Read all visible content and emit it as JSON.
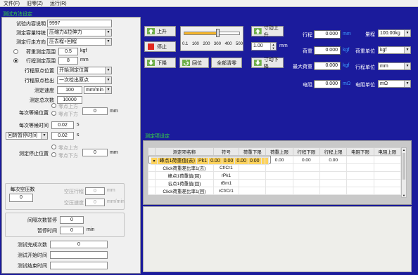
{
  "menu": {
    "file": "文件(F)",
    "history": "旧零(Z)",
    "run": "运行(R)"
  },
  "left": {
    "section_title": "测试方法设定",
    "desc_label": "试验内容说明",
    "desc_value": "9997",
    "char_label": "测定容量特统",
    "char_value": "压缩力&拉伸力",
    "dir_label": "测定行走方向",
    "dir_value": "压去程+回程",
    "load_label": "荷重测定范围",
    "load_value": "0.5",
    "load_unit": "kgf",
    "stroke_label": "行程测定范围",
    "stroke_value": "8",
    "stroke_unit": "mm",
    "startpos_label": "行程原点位置",
    "startpos_value": "开始测定位置",
    "detect_label": "行程原点检出",
    "detect_value": "一次检出原点",
    "speed_label": "测定速度",
    "speed_value": "100",
    "speed_unit": "mm/min",
    "count_label": "测定总次数",
    "count_value": "10000",
    "wait_label": "每次等候位置",
    "wait_opt1": "零点上方",
    "wait_opt2": "零点下方",
    "wait_value": "0",
    "wait_unit": "mm",
    "waittime_label": "每次等候时间",
    "waittime_value": "0.02",
    "waittime_unit": "s",
    "pause_select": "回转暂停时间",
    "pause_value": "0.02",
    "pause_unit": "s",
    "stop_label": "测定停止位置",
    "stop_opt1": "零点上方",
    "stop_opt2": "零点下方",
    "stop_value": "0",
    "stop_unit": "mm",
    "air_label": "每次空压数",
    "air_value": "0",
    "air_stroke_label": "空压行程",
    "air_stroke_value": "0",
    "air_stroke_unit": "mm",
    "air_speed_label": "空压速度",
    "air_speed_value": "0",
    "air_speed_unit": "mm/min",
    "interval_label": "间隔次数暂停",
    "interval_value": "0",
    "pausetime_label": "暂停时间",
    "pausetime_value": "0",
    "pausetime_unit": "min",
    "done_label": "测试完成次数",
    "done_value": "0",
    "starttime_label": "测试开始时间",
    "starttime_value": "",
    "endtime_label": "测试结束时间",
    "endtime_value": ""
  },
  "control": {
    "up": "上升",
    "stop": "停止",
    "down": "下降",
    "return": "回位",
    "zero_all": "全部清零",
    "scale": [
      "0.1",
      "100",
      "200",
      "300",
      "400",
      "500"
    ],
    "speed_fraction": 0.6,
    "inch_up": "寸动上升",
    "inch_down": "寸动下降",
    "inch_value": "1.00",
    "inch_unit": "mm",
    "stroke_label": "行程",
    "stroke_value": "0.000",
    "stroke_unit": "mm",
    "load_label": "荷重",
    "load_value": "0.000",
    "load_unit": "kgf",
    "maxload_label": "最大荷重",
    "maxload_value": "0.000",
    "maxload_unit": "kgf",
    "res_label": "电阻",
    "res_value": "0.000",
    "res_unit": "mΩ",
    "range_label": "量程",
    "range_value": "100.00kg",
    "loadunit_label": "荷重单位",
    "loadunit_value": "kgf",
    "strokeunit_label": "行程单位",
    "strokeunit_value": "mm",
    "resunit_label": "电阻单位",
    "resunit_value": "mΩ"
  },
  "results": {
    "section_title": "测定项设定",
    "headers": [
      "测定项名称",
      "符号",
      "荷重下限",
      "荷重上限",
      "行程下限",
      "行程上限",
      "电阻下限",
      "电阻上限"
    ],
    "rows": [
      [
        "峰点1荷重值(去)",
        "Pk1",
        "0.00",
        "0.00",
        "0.00",
        "0.00",
        "",
        ""
      ],
      [
        "谷点1荷重值(去)",
        "Bm1",
        "0.00",
        "0.00",
        "0.00",
        "0.00",
        "",
        ""
      ],
      [
        "Click荷重差比率1(去)",
        "Cf/Cr1",
        "",
        "",
        "",
        "",
        "",
        ""
      ],
      [
        "峰点1荷重值(回)",
        "rPk1",
        "",
        "",
        "",
        "",
        "",
        ""
      ],
      [
        "谷点1荷重值(回)",
        "rBm1",
        "",
        "",
        "",
        "",
        "",
        ""
      ],
      [
        "Click荷重差比率1(回)",
        "rCf/Cr1",
        "",
        "",
        "",
        "",
        "",
        ""
      ]
    ]
  }
}
